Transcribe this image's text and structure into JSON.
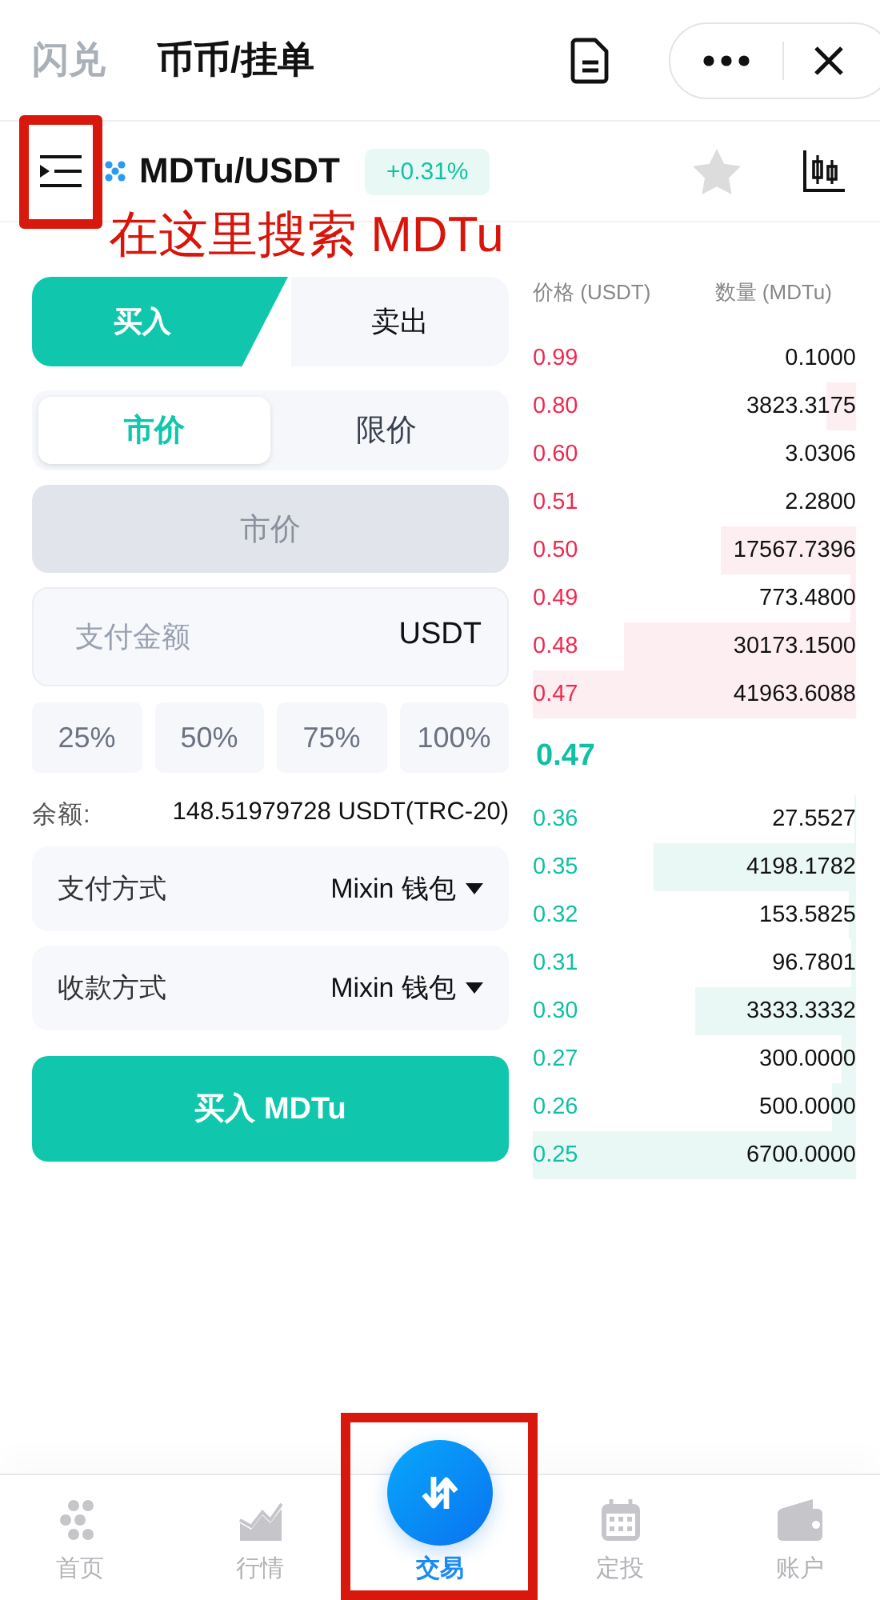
{
  "header": {
    "tabs": [
      {
        "label": "闪兑",
        "selected": false
      },
      {
        "label": "币币/挂单",
        "selected": true
      }
    ]
  },
  "pair": {
    "symbol": "MDTu/USDT",
    "change": "+0.31%",
    "favorite": false
  },
  "annotation": {
    "text": "在这里搜索 MDTu"
  },
  "side_tabs": [
    {
      "label": "买入",
      "selected": true
    },
    {
      "label": "卖出",
      "selected": false
    }
  ],
  "order_types": [
    {
      "label": "市价",
      "selected": true
    },
    {
      "label": "限价",
      "selected": false
    }
  ],
  "price_field": {
    "value": "市价",
    "disabled": true
  },
  "amount_field": {
    "placeholder": "支付金额",
    "unit": "USDT"
  },
  "percent_buttons": [
    "25%",
    "50%",
    "75%",
    "100%"
  ],
  "balance": {
    "label": "余额:",
    "value": "148.51979728 USDT(TRC-20)"
  },
  "methods": [
    {
      "label": "支付方式",
      "value": "Mixin 钱包"
    },
    {
      "label": "收款方式",
      "value": "Mixin 钱包"
    }
  ],
  "submit_button": "买入 MDTu",
  "order_book": {
    "columns": [
      "价格 (USDT)",
      "数量 (MDTu)"
    ],
    "asks": [
      {
        "price": "0.99",
        "amount": "0.1000"
      },
      {
        "price": "0.80",
        "amount": "3823.3175"
      },
      {
        "price": "0.60",
        "amount": "3.0306"
      },
      {
        "price": "0.51",
        "amount": "2.2800"
      },
      {
        "price": "0.50",
        "amount": "17567.7396"
      },
      {
        "price": "0.49",
        "amount": "773.4800"
      },
      {
        "price": "0.48",
        "amount": "30173.1500"
      },
      {
        "price": "0.47",
        "amount": "41963.6088"
      }
    ],
    "last_price": "0.47",
    "bids": [
      {
        "price": "0.36",
        "amount": "27.5527"
      },
      {
        "price": "0.35",
        "amount": "4198.1782"
      },
      {
        "price": "0.32",
        "amount": "153.5825"
      },
      {
        "price": "0.31",
        "amount": "96.7801"
      },
      {
        "price": "0.30",
        "amount": "3333.3332"
      },
      {
        "price": "0.27",
        "amount": "300.0000"
      },
      {
        "price": "0.26",
        "amount": "500.0000"
      },
      {
        "price": "0.25",
        "amount": "6700.0000"
      }
    ]
  },
  "nav": [
    {
      "label": "首页",
      "selected": false
    },
    {
      "label": "行情",
      "selected": false
    },
    {
      "label": "交易",
      "selected": true
    },
    {
      "label": "定投",
      "selected": false
    },
    {
      "label": "账户",
      "selected": false
    }
  ]
}
